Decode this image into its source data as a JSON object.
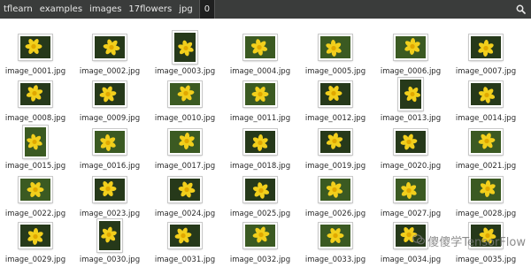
{
  "breadcrumb": [
    "tflearn",
    "examples",
    "images",
    "17flowers",
    "jpg"
  ],
  "active_crumb": "0",
  "icons": {
    "search": "search-icon"
  },
  "watermark_text": "傻傻学TensorFlow",
  "files": [
    {
      "name": "image_0001.jpg",
      "o": "l"
    },
    {
      "name": "image_0002.jpg",
      "o": "l"
    },
    {
      "name": "image_0003.jpg",
      "o": "p"
    },
    {
      "name": "image_0004.jpg",
      "o": "l"
    },
    {
      "name": "image_0005.jpg",
      "o": "l"
    },
    {
      "name": "image_0006.jpg",
      "o": "l"
    },
    {
      "name": "image_0007.jpg",
      "o": "l"
    },
    {
      "name": "image_0008.jpg",
      "o": "l"
    },
    {
      "name": "image_0009.jpg",
      "o": "l"
    },
    {
      "name": "image_0010.jpg",
      "o": "l"
    },
    {
      "name": "image_0011.jpg",
      "o": "l"
    },
    {
      "name": "image_0012.jpg",
      "o": "l"
    },
    {
      "name": "image_0013.jpg",
      "o": "p"
    },
    {
      "name": "image_0014.jpg",
      "o": "l"
    },
    {
      "name": "image_0015.jpg",
      "o": "p"
    },
    {
      "name": "image_0016.jpg",
      "o": "l"
    },
    {
      "name": "image_0017.jpg",
      "o": "l"
    },
    {
      "name": "image_0018.jpg",
      "o": "l"
    },
    {
      "name": "image_0019.jpg",
      "o": "l"
    },
    {
      "name": "image_0020.jpg",
      "o": "l"
    },
    {
      "name": "image_0021.jpg",
      "o": "l"
    },
    {
      "name": "image_0022.jpg",
      "o": "l"
    },
    {
      "name": "image_0023.jpg",
      "o": "l"
    },
    {
      "name": "image_0024.jpg",
      "o": "l"
    },
    {
      "name": "image_0025.jpg",
      "o": "l"
    },
    {
      "name": "image_0026.jpg",
      "o": "l"
    },
    {
      "name": "image_0027.jpg",
      "o": "l"
    },
    {
      "name": "image_0028.jpg",
      "o": "l"
    },
    {
      "name": "image_0029.jpg",
      "o": "l"
    },
    {
      "name": "image_0030.jpg",
      "o": "p"
    },
    {
      "name": "image_0031.jpg",
      "o": "l"
    },
    {
      "name": "image_0032.jpg",
      "o": "l"
    },
    {
      "name": "image_0033.jpg",
      "o": "l"
    },
    {
      "name": "image_0034.jpg",
      "o": "l"
    },
    {
      "name": "image_0035.jpg",
      "o": "l"
    }
  ],
  "colors": {
    "toolbar": "#3a3c3b",
    "toolbar_text": "#e8e8e8",
    "flower": "#f2cf1c",
    "flower_center": "#e0a800",
    "foliage": "#2f4a1c"
  }
}
